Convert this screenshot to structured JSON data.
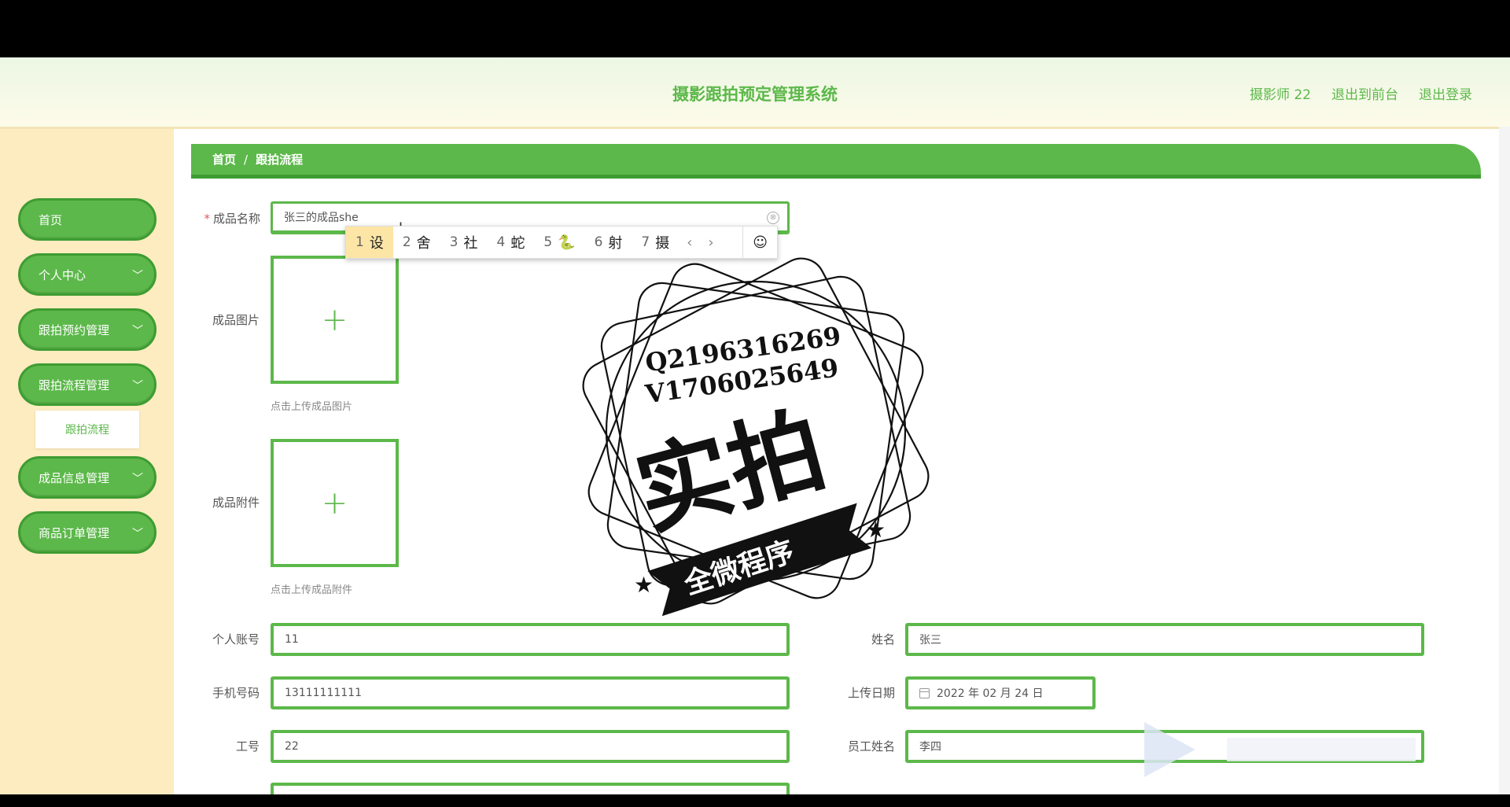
{
  "header": {
    "title": "摄影跟拍预定管理系统",
    "user": "摄影师 22",
    "back_front": "退出到前台",
    "logout": "退出登录"
  },
  "sidebar": {
    "items": [
      {
        "label": "首页"
      },
      {
        "label": "个人中心",
        "chevron": "﹀"
      },
      {
        "label": "跟拍预约管理",
        "chevron": "﹀"
      },
      {
        "label": "跟拍流程管理",
        "chevron": "﹀"
      },
      {
        "label": "成品信息管理",
        "chevron": "﹀"
      },
      {
        "label": "商品订单管理",
        "chevron": "﹀"
      }
    ],
    "submenu": "跟拍流程"
  },
  "breadcrumb": {
    "home": "首页",
    "sep": "/",
    "current": "跟拍流程"
  },
  "form": {
    "name_label": "成品名称",
    "required_mark": "*",
    "name_value": "张三的成品she",
    "clear_icon": "⊗",
    "image_label": "成品图片",
    "image_hint": "点击上传成品图片",
    "attach_label": "成品附件",
    "attach_hint": "点击上传成品附件",
    "plus": "+",
    "account_label": "个人账号",
    "account_value": "11",
    "realname_label": "姓名",
    "realname_value": "张三",
    "phone_label": "手机号码",
    "phone_value": "13111111111",
    "date_label": "上传日期",
    "date_value": "2022 年 02 月 24 日",
    "jobno_label": "工号",
    "jobno_value": "22",
    "staff_label": "员工姓名",
    "staff_value": "李四"
  },
  "ime": {
    "candidates": [
      {
        "n": "1",
        "c": "设"
      },
      {
        "n": "2",
        "c": "舍"
      },
      {
        "n": "3",
        "c": "社"
      },
      {
        "n": "4",
        "c": "蛇"
      },
      {
        "n": "5",
        "c": "🐍"
      },
      {
        "n": "6",
        "c": "射"
      },
      {
        "n": "7",
        "c": "摄"
      }
    ],
    "prev": "‹",
    "next": "›",
    "emoji": "☺"
  },
  "stamp": {
    "line1": "Q2196316269",
    "line2": "V1706025649",
    "big": "实拍",
    "banner": "全微程序"
  },
  "colors": {
    "accent": "#5cb84a",
    "accent_dark": "#3e9c32",
    "sidebar_bg": "#fdecc0"
  }
}
